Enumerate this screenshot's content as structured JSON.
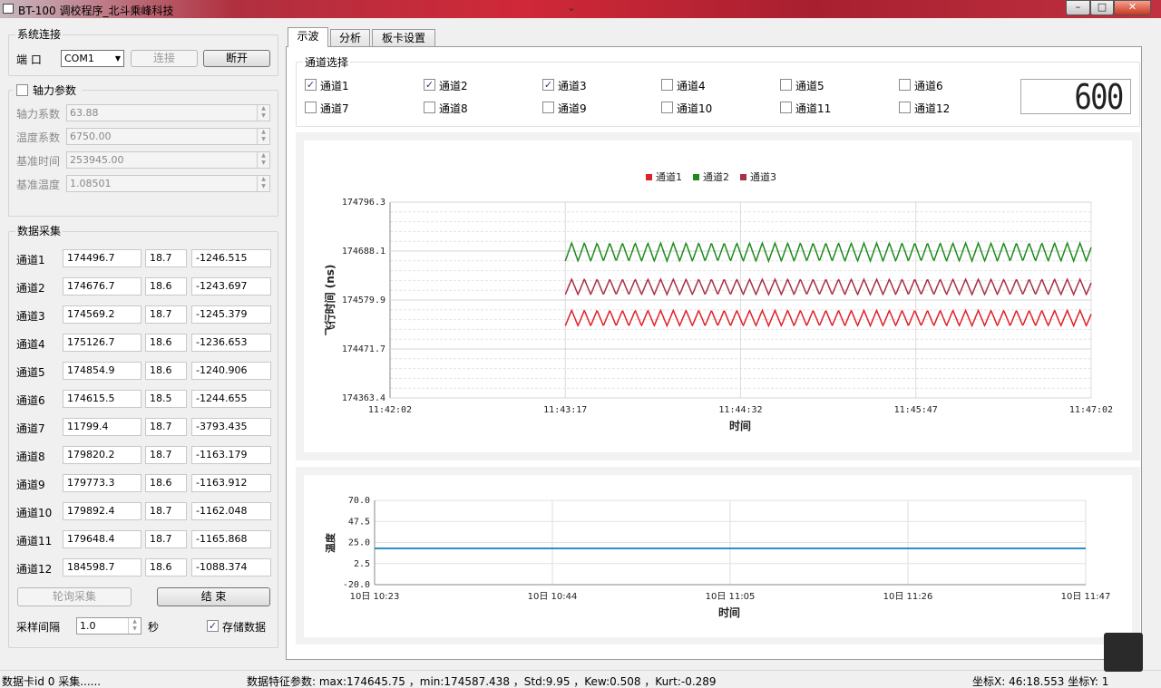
{
  "window": {
    "title": "BT-100 调校程序_北斗乘峰科技"
  },
  "connection": {
    "group_title": "系统连接",
    "port_label": "端 口",
    "port_value": "COM1",
    "connect_label": "连接",
    "disconnect_label": "断开"
  },
  "axial": {
    "group_title": "轴力参数",
    "checked": false,
    "rows": [
      {
        "label": "轴力系数",
        "value": "63.88"
      },
      {
        "label": "温度系数",
        "value": "6750.00"
      },
      {
        "label": "基准时间",
        "value": "253945.00"
      },
      {
        "label": "基准温度",
        "value": "1.08501"
      }
    ]
  },
  "acquisition": {
    "group_title": "数据采集",
    "rows": [
      {
        "label": "通道1",
        "a": "174496.7",
        "b": "18.7",
        "c": "-1246.515"
      },
      {
        "label": "通道2",
        "a": "174676.7",
        "b": "18.6",
        "c": "-1243.697"
      },
      {
        "label": "通道3",
        "a": "174569.2",
        "b": "18.7",
        "c": "-1245.379"
      },
      {
        "label": "通道4",
        "a": "175126.7",
        "b": "18.6",
        "c": "-1236.653"
      },
      {
        "label": "通道5",
        "a": "174854.9",
        "b": "18.6",
        "c": "-1240.906"
      },
      {
        "label": "通道6",
        "a": "174615.5",
        "b": "18.5",
        "c": "-1244.655"
      },
      {
        "label": "通道7",
        "a": "11799.4",
        "b": "18.7",
        "c": "-3793.435"
      },
      {
        "label": "通道8",
        "a": "179820.2",
        "b": "18.7",
        "c": "-1163.179"
      },
      {
        "label": "通道9",
        "a": "179773.3",
        "b": "18.6",
        "c": "-1163.912"
      },
      {
        "label": "通道10",
        "a": "179892.4",
        "b": "18.7",
        "c": "-1162.048"
      },
      {
        "label": "通道11",
        "a": "179648.4",
        "b": "18.7",
        "c": "-1165.868"
      },
      {
        "label": "通道12",
        "a": "184598.7",
        "b": "18.6",
        "c": "-1088.374"
      }
    ],
    "poll_label": "轮询采集",
    "end_label": "结 束",
    "interval_label": "采样间隔",
    "interval_value": "1.0",
    "interval_unit": "秒",
    "store_label": "存储数据",
    "store_checked": true
  },
  "tabs": [
    {
      "label": "示波"
    },
    {
      "label": "分析"
    },
    {
      "label": "板卡设置"
    }
  ],
  "channel_select": {
    "group_title": "通道选择",
    "channels": [
      {
        "label": "通道1",
        "checked": true
      },
      {
        "label": "通道2",
        "checked": true
      },
      {
        "label": "通道3",
        "checked": true
      },
      {
        "label": "通道4",
        "checked": false
      },
      {
        "label": "通道5",
        "checked": false
      },
      {
        "label": "通道6",
        "checked": false
      },
      {
        "label": "通道7",
        "checked": false
      },
      {
        "label": "通道8",
        "checked": false
      },
      {
        "label": "通道9",
        "checked": false
      },
      {
        "label": "通道10",
        "checked": false
      },
      {
        "label": "通道11",
        "checked": false
      },
      {
        "label": "通道12",
        "checked": false
      }
    ],
    "counter_value": "600"
  },
  "chart_data": [
    {
      "type": "line",
      "xlabel": "时间",
      "ylabel": "飞行时间 (ns)",
      "x_ticks": [
        "11:42:02",
        "11:43:17",
        "11:44:32",
        "11:45:47",
        "11:47:02"
      ],
      "y_ticks": [
        "174796.3",
        "174688.1",
        "174579.9",
        "174471.7",
        "174363.4"
      ],
      "ylim": [
        174363.4,
        174796.3
      ],
      "x_data_range_ticks": [
        1,
        4
      ],
      "legend_position": "top-center",
      "grid": true,
      "series": [
        {
          "name": "通道1",
          "color": "#e0202a",
          "center": 174540,
          "amplitude": 17,
          "period_ticks": 0.0725
        },
        {
          "name": "通道2",
          "color": "#1e8a1e",
          "center": 174686,
          "amplitude": 20,
          "period_ticks": 0.0725
        },
        {
          "name": "通道3",
          "color": "#a83048",
          "center": 174609,
          "amplitude": 17,
          "period_ticks": 0.0725
        }
      ]
    },
    {
      "type": "line",
      "xlabel": "时间",
      "ylabel": "温度",
      "x_ticks": [
        "10日 10:23",
        "10日 10:44",
        "10日 11:05",
        "10日 11:26",
        "10日 11:47"
      ],
      "y_ticks": [
        "70.0",
        "47.5",
        "25.0",
        "2.5",
        "-20.0"
      ],
      "ylim": [
        -20,
        70
      ],
      "grid": true,
      "series": [
        {
          "color": "#2a90c8",
          "values": [
            18.7,
            18.7
          ]
        }
      ]
    }
  ],
  "status": {
    "left": "数据卡id 0 采集......",
    "middle": "数据特征参数: max:174645.75 ，min:174587.438 ，Std:9.95 ，Kew:0.508 ，Kurt:-0.289",
    "right": "坐标X: 46:18.553  坐标Y: 1"
  }
}
